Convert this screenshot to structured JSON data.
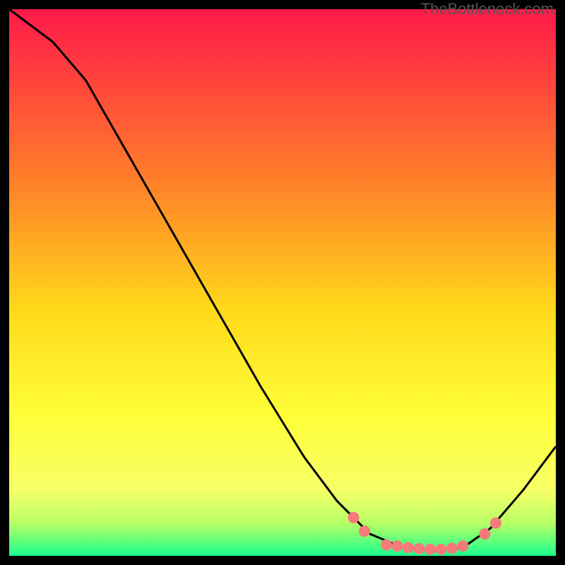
{
  "watermark": "TheBottleneck.com",
  "chart_data": {
    "type": "line",
    "title": "",
    "xlabel": "",
    "ylabel": "",
    "xlim": [
      0,
      100
    ],
    "ylim": [
      0,
      100
    ],
    "background_gradient": {
      "top": "#ff1a4a",
      "mid1": "#ff8c1a",
      "mid2": "#ffe61a",
      "mid3": "#ffff66",
      "mid4": "#ccff66",
      "bottom": "#1aff8c"
    },
    "curve": [
      {
        "x": 0,
        "y": 100
      },
      {
        "x": 8,
        "y": 94
      },
      {
        "x": 14,
        "y": 87
      },
      {
        "x": 22,
        "y": 73
      },
      {
        "x": 30,
        "y": 59
      },
      {
        "x": 38,
        "y": 45
      },
      {
        "x": 46,
        "y": 31
      },
      {
        "x": 54,
        "y": 18
      },
      {
        "x": 60,
        "y": 10
      },
      {
        "x": 66,
        "y": 4
      },
      {
        "x": 72,
        "y": 1.5
      },
      {
        "x": 78,
        "y": 1
      },
      {
        "x": 83,
        "y": 1.5
      },
      {
        "x": 88,
        "y": 5
      },
      {
        "x": 94,
        "y": 12
      },
      {
        "x": 100,
        "y": 20
      }
    ],
    "dots": [
      {
        "x": 63,
        "y": 7
      },
      {
        "x": 65,
        "y": 4.5
      },
      {
        "x": 69,
        "y": 2
      },
      {
        "x": 71,
        "y": 1.8
      },
      {
        "x": 73,
        "y": 1.5
      },
      {
        "x": 75,
        "y": 1.3
      },
      {
        "x": 77,
        "y": 1.2
      },
      {
        "x": 79,
        "y": 1.2
      },
      {
        "x": 81,
        "y": 1.4
      },
      {
        "x": 83,
        "y": 1.8
      },
      {
        "x": 87,
        "y": 4
      },
      {
        "x": 89,
        "y": 6
      }
    ]
  }
}
